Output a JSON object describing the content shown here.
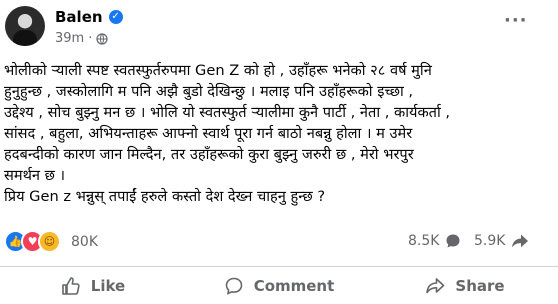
{
  "author": {
    "name": "Balen",
    "time": "39m"
  },
  "post": {
    "lines": [
      "भोलीको र्‍याली स्पष्ट स्वतस्फुर्तरुपमा Gen Z को हो , उहाँहरू भनेको २८ वर्ष मुनि",
      "हुनुहुन्छ , जस्कोलागि म पनि अझै बुडो देखिन्छु । मलाइ पनि उहाँहरूको इच्छा ,",
      "उद्देश्य , सोच बुझ्नु मन छ । भोलि यो स्वतस्फुर्त र्‍यालीमा कुनै पार्टी , नेता , कार्यकर्ता ,",
      "सांसद , बहुला, अभियन्ताहरू आफ्नो स्वार्थ पूरा गर्न बाठो नबन्नु होला । म उमेर",
      "हदबन्दीको कारण जान मिल्दैन, तर उहाँहरूको कुरा बुझ्नु जरुरी छ , मेरो भरपुर",
      "समर्थन छ ।",
      "प्रिय Gen z भन्नुस् तपाईं हरुले कस्तो देश देख्न चाहनु हुन्छ ?"
    ]
  },
  "stats": {
    "reactions": "80K",
    "comments": "8.5K",
    "shares": "5.9K"
  },
  "actions": {
    "like": "Like",
    "comment": "Comment",
    "share": "Share"
  },
  "icons": {
    "verified": "verified-badge-icon",
    "privacy": "globe-icon",
    "more": "more-options-icon",
    "reactions": [
      "like-reaction-icon",
      "love-reaction-icon",
      "care-reaction-icon"
    ]
  }
}
